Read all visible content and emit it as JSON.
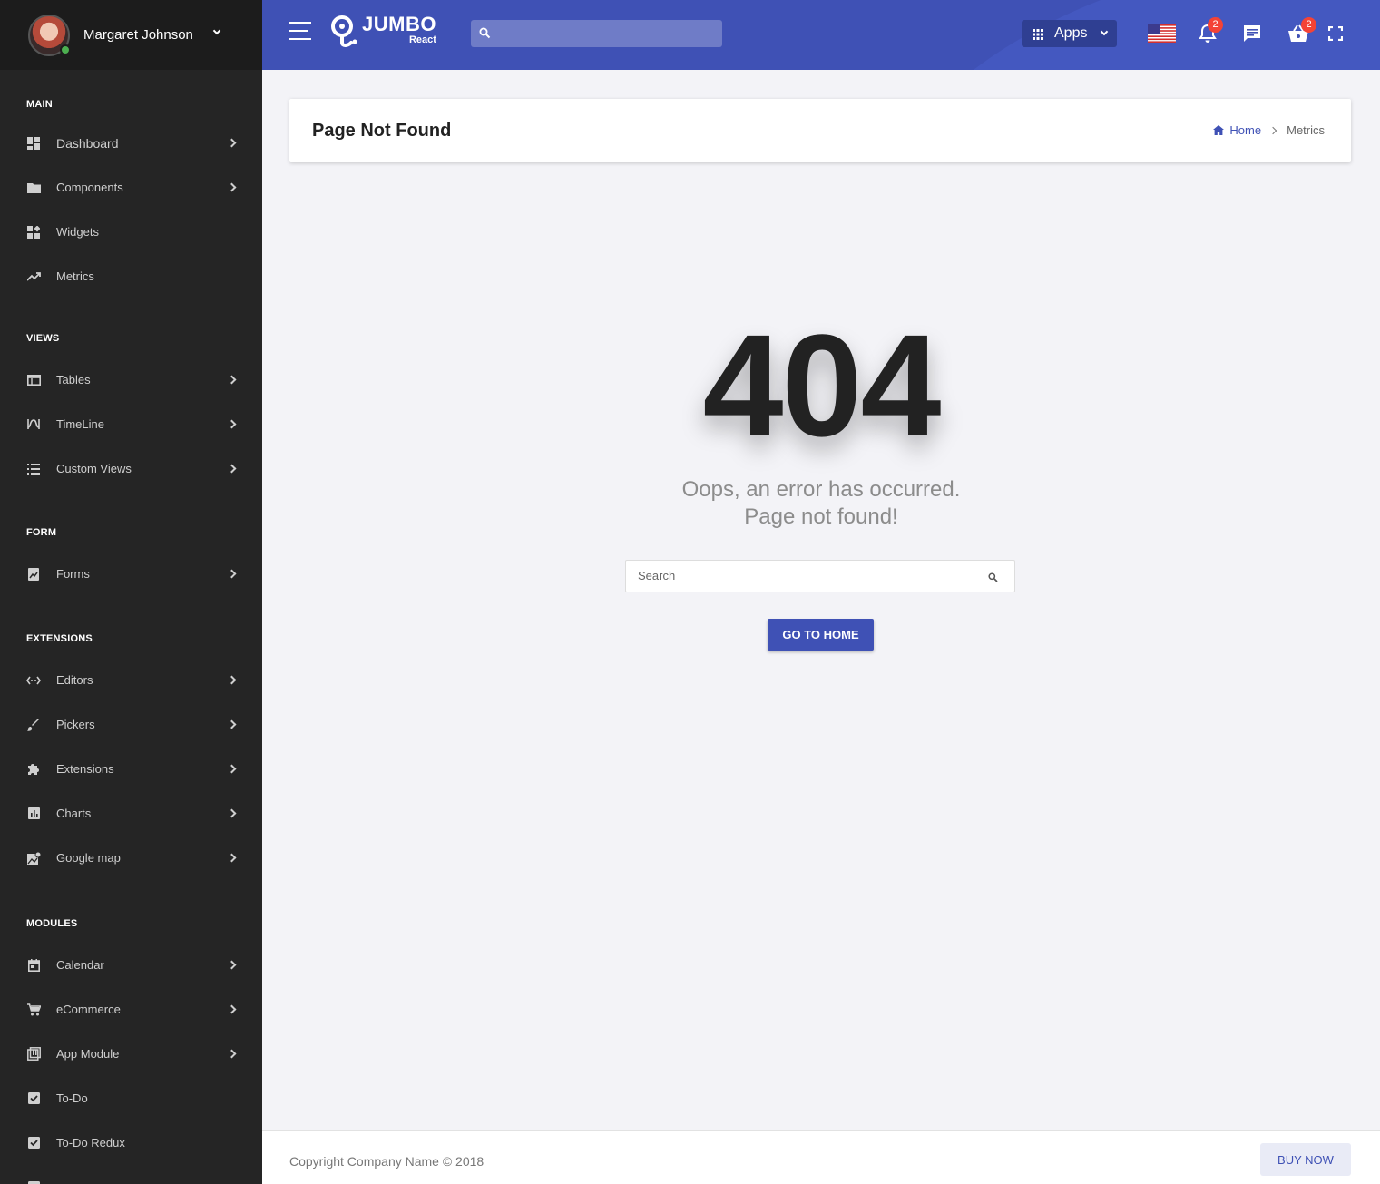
{
  "user": {
    "name": "Margaret Johnson"
  },
  "sidebar": {
    "sections": [
      {
        "title": "MAIN",
        "items": [
          "Dashboard",
          "Components",
          "Widgets",
          "Metrics"
        ]
      },
      {
        "title": "VIEWS",
        "items": [
          "Tables",
          "TimeLine",
          "Custom Views"
        ]
      },
      {
        "title": "FORM",
        "items": [
          "Forms"
        ]
      },
      {
        "title": "EXTENSIONS",
        "items": [
          "Editors",
          "Pickers",
          "Extensions",
          "Charts",
          "Google map"
        ]
      },
      {
        "title": "MODULES",
        "items": [
          "Calendar",
          "eCommerce",
          "App Module",
          "To-Do",
          "To-Do Redux"
        ]
      }
    ],
    "labels": {
      "main": "MAIN",
      "views": "VIEWS",
      "form": "FORM",
      "extensions": "EXTENSIONS",
      "modules": "MODULES",
      "dashboard": "Dashboard",
      "components": "Components",
      "widgets": "Widgets",
      "metrics": "Metrics",
      "tables": "Tables",
      "timeline": "TimeLine",
      "custom_views": "Custom Views",
      "forms": "Forms",
      "editors": "Editors",
      "pickers": "Pickers",
      "extensions_item": "Extensions",
      "charts": "Charts",
      "google_map": "Google map",
      "calendar": "Calendar",
      "ecommerce": "eCommerce",
      "app_module": "App Module",
      "todo": "To-Do",
      "todo_redux": "To-Do Redux"
    }
  },
  "header": {
    "logo_text": "JUMBO",
    "logo_sub": "React",
    "apps_label": "Apps",
    "notification_count": "2",
    "cart_count": "2"
  },
  "page": {
    "title": "Page Not Found",
    "breadcrumb_home": "Home",
    "breadcrumb_current": "Metrics"
  },
  "error": {
    "code": "404",
    "line1": "Oops, an error has occurred.",
    "line2": "Page not found!",
    "search_placeholder": "Search",
    "button": "GO TO HOME"
  },
  "footer": {
    "copyright": "Copyright Company Name © 2018",
    "buy_button": "BUY NOW"
  },
  "colors": {
    "primary": "#3f51b5",
    "sidebar": "#252525",
    "badge": "#f44336",
    "online": "#4caf50"
  }
}
